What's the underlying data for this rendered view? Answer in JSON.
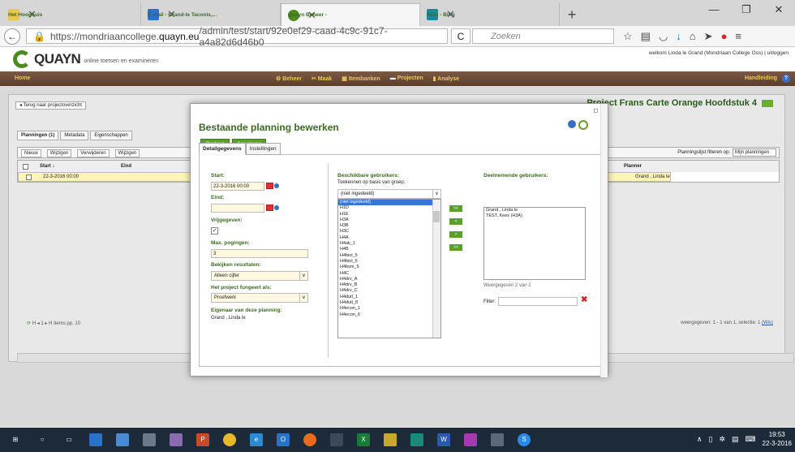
{
  "browser": {
    "tabs": [
      {
        "label": "Het Hooghuis",
        "icon": "hooghuis-icon",
        "active": false
      },
      {
        "label": "E-mail - Grand-le Taconis,...",
        "icon": "mail-icon",
        "active": false
      },
      {
        "label": "Quayn Beheer -",
        "icon": "quayn-icon",
        "active": true
      },
      {
        "label": "Voor - Bing",
        "icon": "bing-icon",
        "active": false
      }
    ],
    "url_prefix": "https://mondriaancollege.",
    "url_domain": "quayn.eu",
    "url_path": "/admin/test/start/92e0ef29-caad-4c9c-91c7-a4a82d6d46b0",
    "search_placeholder": "Zoeken"
  },
  "app": {
    "logo": "QUAYN",
    "tagline": "online toetsen en examineren",
    "welcome": "welkom Linda le Grand (Mondriaan College Oss) | uitloggen",
    "menu_home": "Home",
    "menu_items": [
      "Beheer",
      "Maak",
      "Itembanken",
      "Projecten",
      "Analyse"
    ],
    "menu_help": "Handleiding",
    "back_label": "Terug naar projectoverzicht",
    "project_title": "Project Frans Carte Orange Hoofdstuk 4",
    "subtabs": [
      "Planningen (1)",
      "Metadata",
      "Eigenschappen"
    ],
    "toolbar": [
      "Nieuw",
      "Wijzigen",
      "Verwijderen",
      "Wijzigen"
    ],
    "filter_label": "Planningslijst filteren op:",
    "filter_value": "Mijn planningen",
    "grid_headers": {
      "start": "Start ↓",
      "eind": "Eind",
      "planner": "Planner"
    },
    "grid_row": {
      "start": "22-3-2016 00:00",
      "planner": "Grand , Linda le"
    },
    "pager": "H  ◂  1  ▸  H    Items pp. 10",
    "pager_right": "weergegeven: 1 - 1 van 1,  selectie: 1",
    "pager_right_link": "(Wis)"
  },
  "dialog": {
    "title": "Bestaande planning bewerken",
    "save": "Opslaan",
    "cancel": "Annuleren",
    "tabs": [
      "Detailgegevens",
      "Instellingen"
    ],
    "start_label": "Start:",
    "start_value": "22-3-2016 00:00",
    "end_label": "Eind:",
    "release_label": "Vrijgegeven:",
    "max_label": "Max. pogingen:",
    "max_value": "3",
    "view_label": "Bekijken resultaten:",
    "view_value": "Alleen cijfer",
    "role_label": "Het project fungeert als:",
    "role_value": "Proefwerk",
    "owner_label": "Eigenaar van deze planning:",
    "owner_value": "Grand , Linda le",
    "available_label": "Beschikbare gebruikers:",
    "assign_label": "Toekennen op basis van groep:",
    "group_select": "(niet ingedeeld)",
    "group_options": [
      "(niet ingedeeld)",
      "H1D",
      "H1E",
      "H3A",
      "H3B",
      "H3C",
      "H4A",
      "H4ak_1",
      "H4B",
      "H4biol_5",
      "H4biol_6",
      "H4bsm_5",
      "H4C",
      "H4drv_A",
      "H4drv_B",
      "H4drv_C",
      "H4dutl_1",
      "H4dutl_8",
      "H4econ_1",
      "H4econ_6"
    ],
    "participants_label": "Deelnemende gebruikers:",
    "participants": [
      "Grand , Linda le",
      "TEST, Kees (H3A)"
    ],
    "shown": "Weergegeven 2 van 2",
    "filter_label": "Filter:",
    "move_buttons": [
      "<<",
      "<",
      ">",
      ">>"
    ]
  },
  "taskbar": {
    "time": "19:53",
    "date": "22-3-2016"
  }
}
